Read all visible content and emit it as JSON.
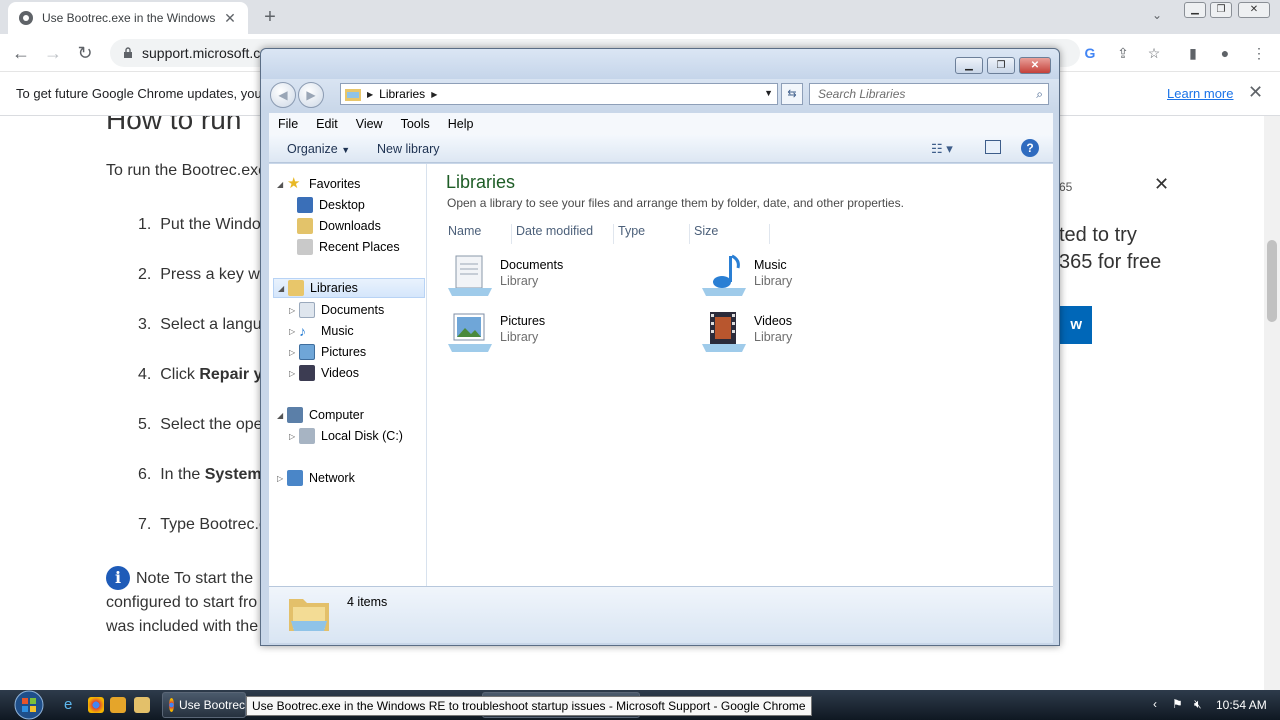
{
  "browser": {
    "tab_title": "Use Bootrec.exe in the Windows",
    "new_tab_symbol": "+",
    "url": "support.microsoft.c",
    "infobar_message": "To get future Google Chrome updates, you",
    "infobar_link": "Learn more"
  },
  "page": {
    "heading": "How to run",
    "intro": "To run the Bootrec.exe",
    "steps": [
      {
        "num": "1.",
        "text": "Put the Windo"
      },
      {
        "num": "2.",
        "text": "Press a key wh"
      },
      {
        "num": "3.",
        "text": "Select a langu"
      },
      {
        "num": "4.",
        "text_plain": "Click ",
        "text_bold": "Repair y"
      },
      {
        "num": "5.",
        "text": "Select the ope"
      },
      {
        "num": "6.",
        "text_plain": "In the ",
        "text_bold": "System"
      },
      {
        "num": "7.",
        "text": "Type Bootrec.e"
      }
    ],
    "note_line1": "Note To start the",
    "note_line2": "configured to start fro",
    "note_line3": "was included with the",
    "promo_small": "65",
    "promo_line1": "ted to try",
    "promo_line2": "365 for free",
    "promo_button": "w"
  },
  "explorer": {
    "breadcrumb": "Libraries",
    "search_placeholder": "Search Libraries",
    "menu": [
      "File",
      "Edit",
      "View",
      "Tools",
      "Help"
    ],
    "organize": "Organize",
    "new_library": "New library",
    "nav": {
      "favorites": "Favorites",
      "desktop": "Desktop",
      "downloads": "Downloads",
      "recent_places": "Recent Places",
      "libraries": "Libraries",
      "documents": "Documents",
      "music": "Music",
      "pictures": "Pictures",
      "videos": "Videos",
      "computer": "Computer",
      "local_disk": "Local Disk (C:)",
      "network": "Network"
    },
    "content_title": "Libraries",
    "content_desc": "Open a library to see your files and arrange them by folder, date, and other properties.",
    "columns": [
      "Name",
      "Date modified",
      "Type",
      "Size"
    ],
    "items": [
      {
        "name": "Documents",
        "type": "Library"
      },
      {
        "name": "Music",
        "type": "Library"
      },
      {
        "name": "Pictures",
        "type": "Library"
      },
      {
        "name": "Videos",
        "type": "Library"
      }
    ],
    "item_count": "4 items"
  },
  "taskbar": {
    "task_label": "Use Bootrec",
    "tooltip": "Use Bootrec.exe in the Windows RE to troubleshoot startup issues - Microsoft Support - Google Chrome",
    "clock": "10:54 AM"
  }
}
